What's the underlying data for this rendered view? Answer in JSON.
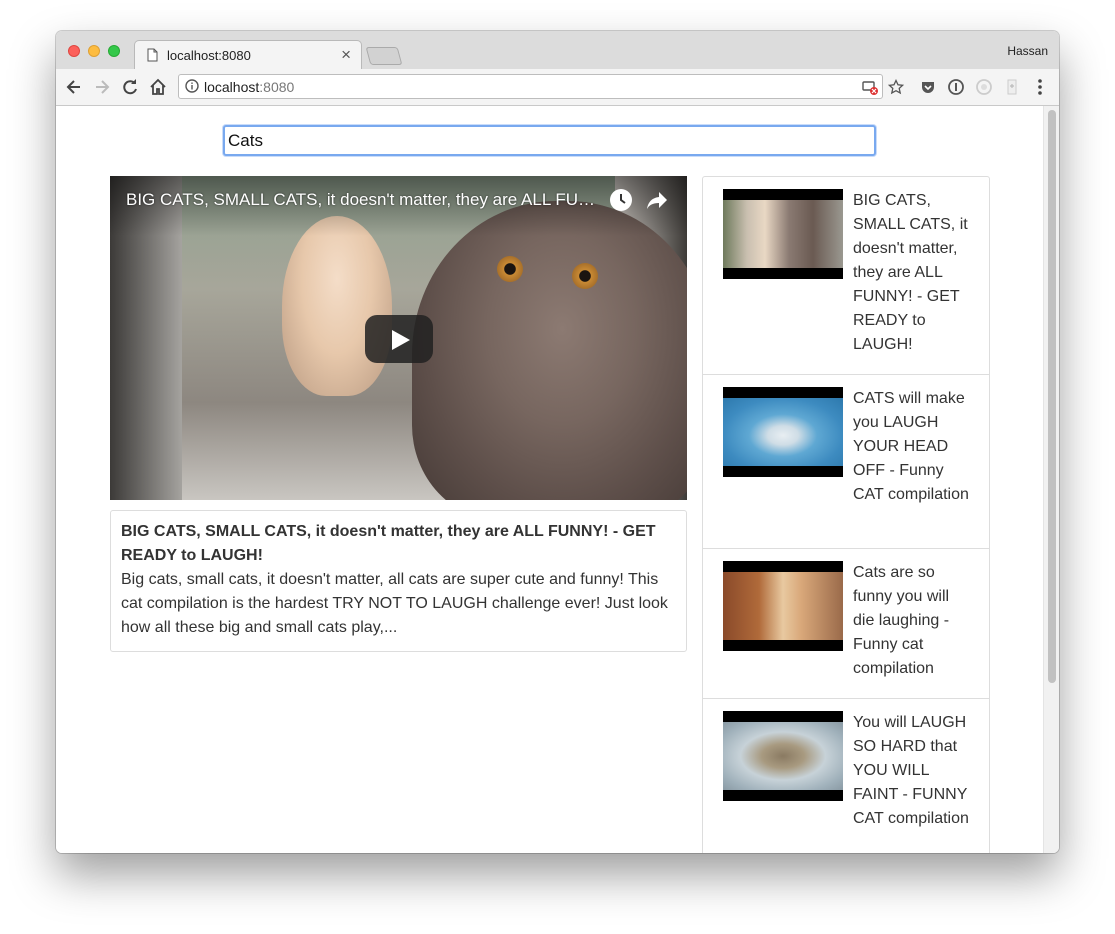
{
  "browser": {
    "tab_title": "localhost:8080",
    "tab_close": "×",
    "profile_name": "Hassan",
    "url_host": "localhost",
    "url_port": ":8080"
  },
  "search": {
    "value": "Cats"
  },
  "player": {
    "title": "BIG CATS, SMALL CATS, it doesn't matter, they are ALL FUNNY! - GET READY to LAUGH!"
  },
  "details": {
    "title": "BIG CATS, SMALL CATS, it doesn't matter, they are ALL FUNNY! - GET READY to LAUGH!",
    "description": "Big cats, small cats, it doesn't matter, all cats are super cute and funny! This cat compilation is the hardest TRY NOT TO LAUGH challenge ever! Just look how all these big and small cats play,..."
  },
  "video_list": [
    {
      "title": "BIG CATS, SMALL CATS, it doesn't matter, they are ALL FUNNY! - GET READY to LAUGH!"
    },
    {
      "title": "CATS will make you LAUGH YOUR HEAD OFF - Funny CAT compilation"
    },
    {
      "title": "Cats are so funny you will die laughing - Funny cat compilation"
    },
    {
      "title": "You will LAUGH SO HARD that YOU WILL FAINT - FUNNY CAT compilation"
    }
  ],
  "icons": {
    "back": "back-arrow-icon",
    "forward": "forward-arrow-icon",
    "reload": "reload-icon",
    "home": "home-icon",
    "info": "info-icon",
    "star": "star-icon",
    "menu": "kebab-menu-icon"
  },
  "colors": {
    "search_focus": "#79a9ef",
    "border": "#dddddd",
    "text": "#333333"
  }
}
